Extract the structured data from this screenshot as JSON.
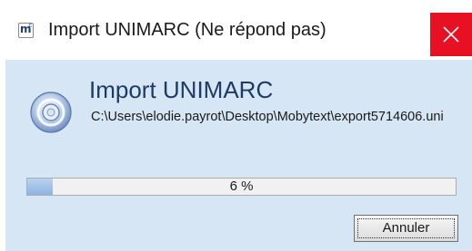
{
  "window": {
    "title": "Import UNIMARC (Ne répond pas)",
    "app_icon": {
      "name": "mobytext-app-icon",
      "letter": "m",
      "sup": "c"
    },
    "close_icon": "close-icon",
    "close_color": "#e81123"
  },
  "dialog": {
    "heading": "Import UNIMARC",
    "path": "C:\\Users\\elodie.payrot\\Desktop\\Mobytext\\export5714606.uni",
    "icon": "disc-icon",
    "background": "#d6e6f5"
  },
  "progress": {
    "percent": 6,
    "label": "6 %"
  },
  "buttons": {
    "cancel_label": "Annuler"
  }
}
